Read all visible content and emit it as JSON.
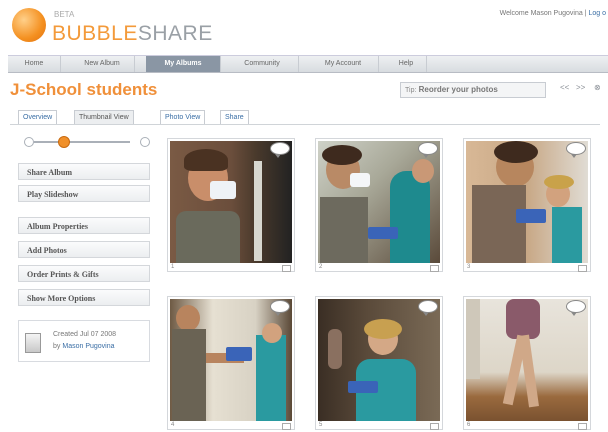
{
  "header": {
    "logo_beta": "BETA",
    "logo_main": "BUBBLE",
    "logo_accent": "SHARE",
    "welcome_text": "Welcome Mason Pugovina",
    "welcome_link": "Log o"
  },
  "nav": {
    "tabs": [
      {
        "label": "Home",
        "active": false
      },
      {
        "label": "New Album",
        "active": false
      },
      {
        "label": "My Albums",
        "active": true
      },
      {
        "label": "Community",
        "active": false
      },
      {
        "label": "My Account",
        "active": false
      },
      {
        "label": "Help",
        "active": false
      }
    ]
  },
  "album": {
    "title": "J-School students"
  },
  "tip": {
    "label": "Tip:",
    "text": "Reorder your photos",
    "prev": "<<",
    "next": ">>",
    "close": "⊗"
  },
  "view_tabs": [
    {
      "label": "Overview",
      "active": false
    },
    {
      "label": "Thumbnail View",
      "active": true
    },
    {
      "label": "Photo View",
      "active": false
    },
    {
      "label": "Share",
      "active": false
    }
  ],
  "zoom": {
    "level": 0.3
  },
  "sidebar": {
    "buttons": [
      "Share Album",
      "Play Slideshow",
      "Album Properties",
      "Add Photos",
      "Order Prints & Gifts",
      "Show More Options"
    ],
    "created_line1": "Created Jul 07 2008",
    "created_by_prefix": "by",
    "created_by_name": "Mason Pugovina"
  },
  "photos": [
    {
      "index": "1"
    },
    {
      "index": "2"
    },
    {
      "index": "3"
    },
    {
      "index": "4"
    },
    {
      "index": "5"
    },
    {
      "index": "6"
    }
  ],
  "colors": {
    "brand_orange": "#f0903a",
    "link_blue": "#3a6ea5",
    "nav_active": "#8a96a4"
  }
}
